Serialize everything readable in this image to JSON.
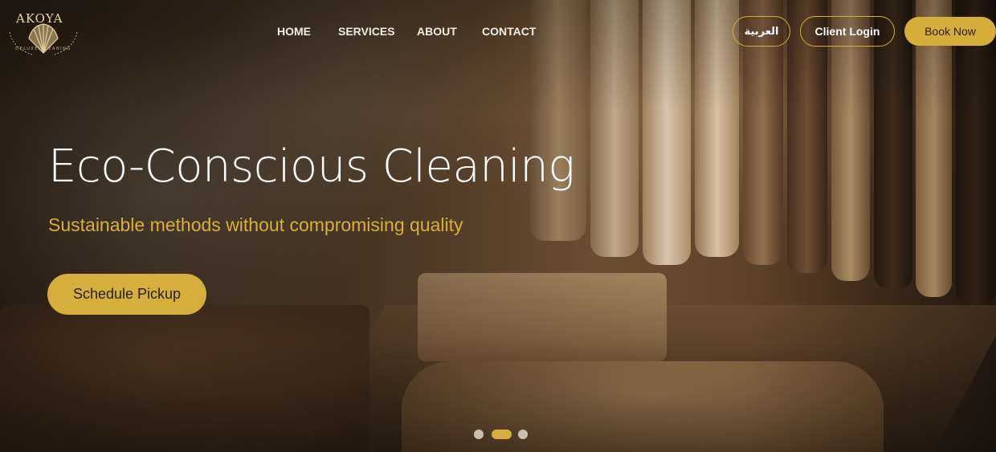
{
  "brand": {
    "name": "AKOYA",
    "tagline": "DELUXE CLEANING",
    "accent_color": "#d4ad3a"
  },
  "nav": {
    "items": [
      {
        "label": "HOME"
      },
      {
        "label": "SERVICES"
      },
      {
        "label": "ABOUT"
      },
      {
        "label": "CONTACT"
      }
    ]
  },
  "header_actions": {
    "language_label": "العربية",
    "login_label": "Client Login",
    "book_label": "Book Now"
  },
  "hero": {
    "headline": "Eco-Conscious Cleaning",
    "subheadline": "Sustainable methods without compromising quality",
    "cta_label": "Schedule Pickup",
    "background_image": "steam-ironing-garments-photo"
  },
  "carousel": {
    "slide_count": 3,
    "active_index": 1
  }
}
